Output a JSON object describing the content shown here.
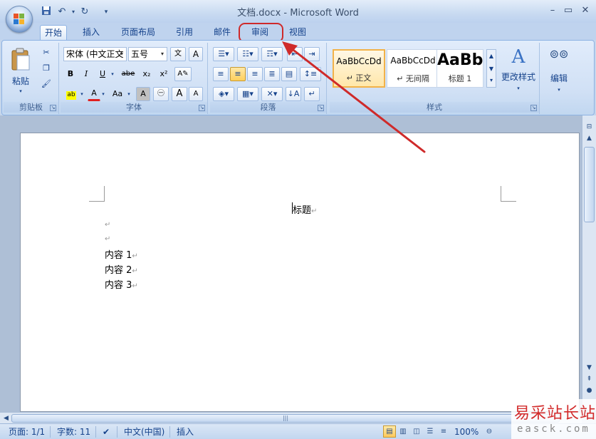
{
  "window": {
    "title": "文档.docx - Microsoft Word",
    "minimize": "–",
    "maximize": "▭",
    "close": "✕"
  },
  "quick_access": {
    "save_icon": "save-icon",
    "undo_icon": "undo-icon",
    "redo_icon": "redo-icon"
  },
  "tabs": [
    {
      "label": "开始",
      "active": true
    },
    {
      "label": "插入"
    },
    {
      "label": "页面布局"
    },
    {
      "label": "引用"
    },
    {
      "label": "邮件"
    },
    {
      "label": "审阅",
      "highlighted": true
    },
    {
      "label": "视图"
    }
  ],
  "ribbon": {
    "clipboard": {
      "label": "剪贴板",
      "paste_label": "粘贴"
    },
    "font": {
      "label": "字体",
      "font_name": "宋体 (中文正文",
      "font_size": "五号",
      "bold": "B",
      "italic": "I",
      "underline": "U",
      "strike": "abe",
      "subscript": "x₂",
      "superscript": "x²",
      "grow": "A",
      "shrink": "A",
      "change_case": "Aa",
      "char_border": "A"
    },
    "paragraph": {
      "label": "段落"
    },
    "styles": {
      "label": "样式",
      "cards": [
        {
          "sample": "AaBbCcDd",
          "name": "↵ 正文",
          "active": true
        },
        {
          "sample": "AaBbCcDd",
          "name": "↵ 无间隔"
        },
        {
          "sample": "AaBb",
          "name": "标题 1"
        }
      ],
      "change_styles_label": "更改样式"
    },
    "editing": {
      "label": "编辑"
    }
  },
  "document": {
    "title_line": "标题",
    "lines": [
      "内容 1",
      "内容 2",
      "内容 3"
    ],
    "para_mark": "↵"
  },
  "status": {
    "page": "页面: 1/1",
    "words": "字数: 11",
    "language": "中文(中国)",
    "mode": "插入",
    "zoom": "100%"
  },
  "watermark": {
    "cn": "易采站长站",
    "en": "easck.com"
  },
  "colors": {
    "annotation_red": "#cf2a2a",
    "ribbon_blue": "#d0e0f5"
  }
}
